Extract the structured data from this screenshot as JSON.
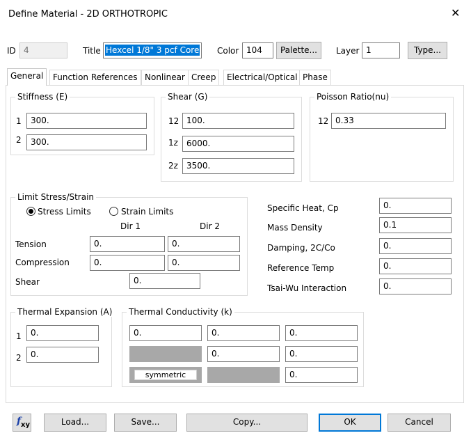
{
  "window": {
    "title": "Define Material - 2D ORTHOTROPIC",
    "close_glyph": "✕"
  },
  "header": {
    "id_label": "ID",
    "id_value": "4",
    "title_label": "Title",
    "title_value": "Hexcel 1/8\" 3 pcf Core",
    "color_label": "Color",
    "color_value": "104",
    "palette_button": "Palette...",
    "layer_label": "Layer",
    "layer_value": "1",
    "type_button": "Type..."
  },
  "tabs": [
    {
      "label": "General",
      "active": true
    },
    {
      "label": "Function References"
    },
    {
      "label": "Nonlinear"
    },
    {
      "label": "Creep"
    },
    {
      "label": "Electrical/Optical"
    },
    {
      "label": "Phase"
    }
  ],
  "stiffness": {
    "title": "Stiffness (E)",
    "rows": [
      {
        "label": "1",
        "value": "300."
      },
      {
        "label": "2",
        "value": "300."
      }
    ]
  },
  "shear": {
    "title": "Shear (G)",
    "rows": [
      {
        "label": "12",
        "value": "100."
      },
      {
        "label": "1z",
        "value": "6000."
      },
      {
        "label": "2z",
        "value": "3500."
      }
    ]
  },
  "poisson": {
    "title": "Poisson Ratio(nu)",
    "rows": [
      {
        "label": "12",
        "value": "0.33"
      }
    ]
  },
  "limit": {
    "title": "Limit Stress/Strain",
    "radio_stress": "Stress Limits",
    "radio_strain": "Strain Limits",
    "dir1": "Dir 1",
    "dir2": "Dir 2",
    "tension_label": "Tension",
    "tension_1": "0.",
    "tension_2": "0.",
    "compression_label": "Compression",
    "compression_1": "0.",
    "compression_2": "0.",
    "shear_label": "Shear",
    "shear_value": "0."
  },
  "props": [
    {
      "label": "Specific Heat, Cp",
      "value": "0."
    },
    {
      "label": "Mass Density",
      "value": "0.1"
    },
    {
      "label": "Damping, 2C/Co",
      "value": "0."
    },
    {
      "label": "Reference Temp",
      "value": "0."
    },
    {
      "label": "Tsai-Wu Interaction",
      "value": "0."
    }
  ],
  "thermal_expansion": {
    "title": "Thermal Expansion (A)",
    "rows": [
      {
        "label": "1",
        "value": "0."
      },
      {
        "label": "2",
        "value": "0."
      }
    ]
  },
  "thermal_conductivity": {
    "title": "Thermal Conductivity (k)",
    "r1": [
      "0.",
      "0.",
      "0."
    ],
    "r2": [
      "0.",
      "0."
    ],
    "r3": [
      "0."
    ],
    "symmetric_label": "symmetric"
  },
  "footer": {
    "fxy_f": "f",
    "fxy_sub": "xy",
    "load": "Load...",
    "save": "Save...",
    "copy": "Copy...",
    "ok": "OK",
    "cancel": "Cancel"
  },
  "colors": {
    "accent": "#0078d7",
    "disabled_fill": "#a8a8a8",
    "fx_blue": "#1a3fa8"
  }
}
